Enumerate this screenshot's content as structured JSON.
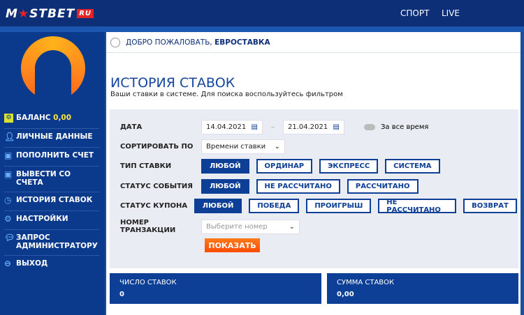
{
  "header": {
    "logo": "MOSTBET",
    "logo_suffix": "RU",
    "nav": [
      "СПОРТ",
      "LIVE"
    ]
  },
  "sidebar": {
    "balance_label": "БАЛАНС",
    "balance_value": "0,00",
    "items": [
      {
        "icon": "user-icon",
        "label": "ЛИЧНЫЕ ДАННЫЕ"
      },
      {
        "icon": "deposit-icon",
        "label": "ПОПОЛНИТЬ СЧЕТ"
      },
      {
        "icon": "withdraw-icon",
        "label": "ВЫВЕСТИ СО СЧЕТА"
      },
      {
        "icon": "clock-icon",
        "label": "ИСТОРИЯ СТАВОК"
      },
      {
        "icon": "gear-icon",
        "label": "НАСТРОЙКИ"
      },
      {
        "icon": "chat-icon",
        "label": "ЗАПРОС АДМИНИСТРАТОРУ"
      },
      {
        "icon": "logout-icon",
        "label": "ВЫХОД"
      }
    ]
  },
  "welcome": {
    "text": "ДОБРО ПОЖАЛОВАТЬ,",
    "name": "ЕВРОСТАВКА"
  },
  "page": {
    "title": "ИСТОРИЯ СТАВОК",
    "subtitle": "Ваши ставки в системе. Для поиска воспользуйтесь фильтром"
  },
  "filters": {
    "date_label": "ДАТА",
    "date_from": "14.04.2021",
    "date_sep": "–",
    "date_to": "21.04.2021",
    "all_time": "За все время",
    "sort_label": "СОРТИРОВАТЬ ПО",
    "sort_value": "Времени ставки",
    "type_label": "ТИП СТАВКИ",
    "type_options": [
      "ЛЮБОЙ",
      "ОРДИНАР",
      "ЭКСПРЕСС",
      "СИСТЕМА"
    ],
    "event_label": "СТАТУС СОБЫТИЯ",
    "event_options": [
      "ЛЮБОЙ",
      "НЕ РАССЧИТАНО",
      "РАССЧИТАНО"
    ],
    "coupon_label": "СТАТУС КУПОНА",
    "coupon_options": [
      "ЛЮБОЙ",
      "ПОБЕДА",
      "ПРОИГРЫШ",
      "НЕ РАССЧИТАНО",
      "ВОЗВРАТ"
    ],
    "txn_label": "НОМЕР ТРАНЗАКЦИИ",
    "txn_placeholder": "Выберите номер",
    "show_button": "ПОКАЗАТЬ"
  },
  "stats": {
    "count_label": "ЧИСЛО СТАВОК",
    "count_value": "0",
    "sum_label": "СУММА СТАВОК",
    "sum_value": "0,00"
  }
}
